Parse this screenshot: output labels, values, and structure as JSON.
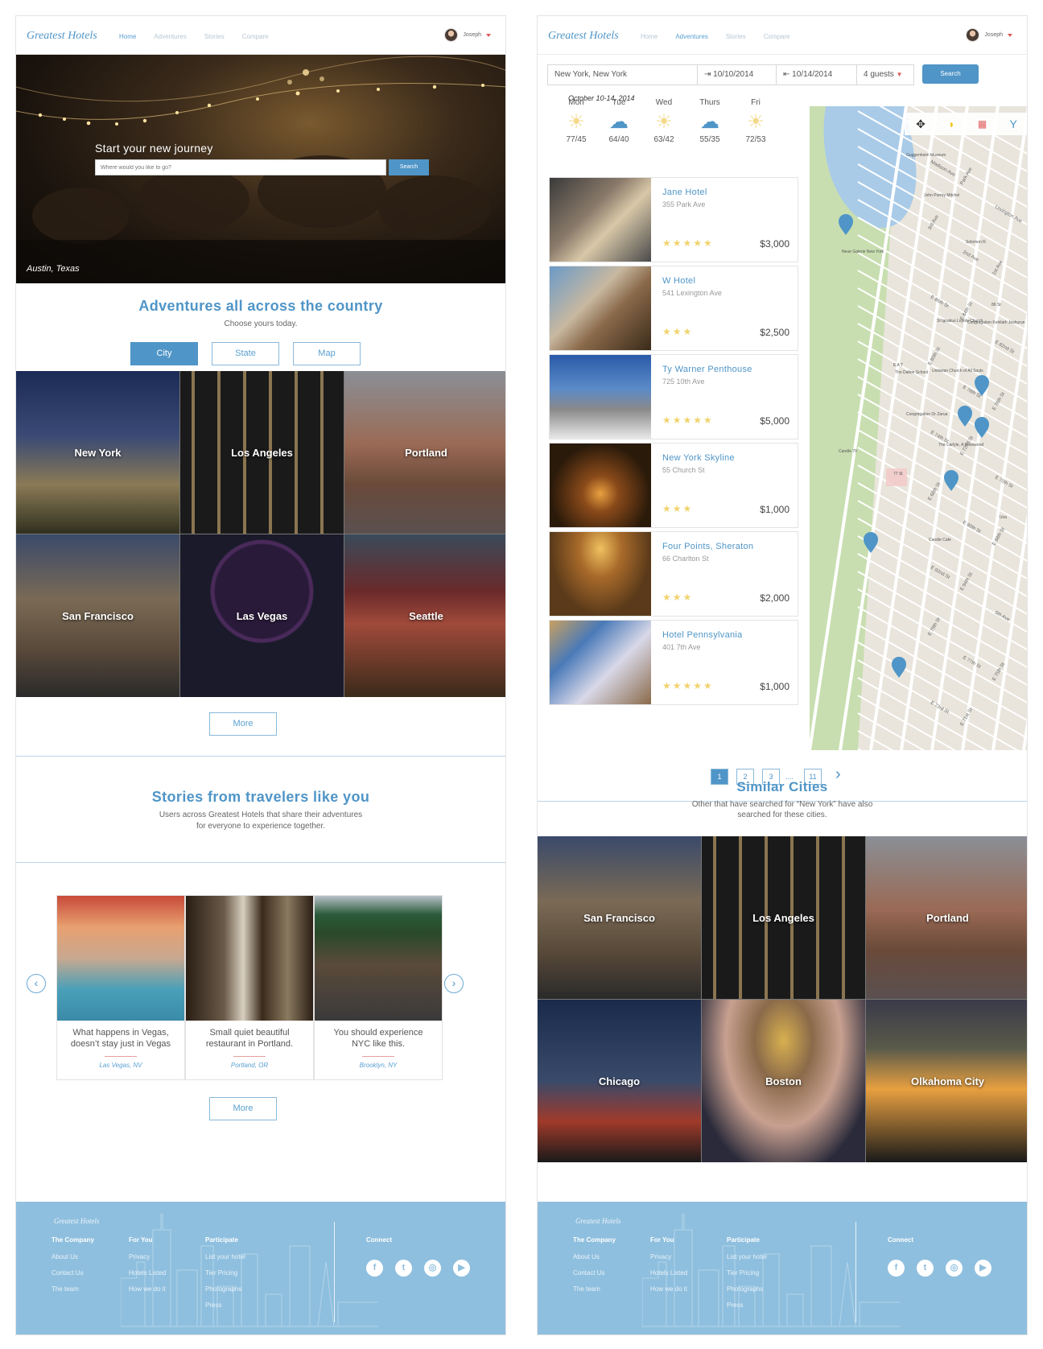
{
  "brand": {
    "logo": "Greatest Hotels"
  },
  "page1": {
    "nav": [
      "Home",
      "Adventures",
      "Stories",
      "Compare"
    ],
    "active": 0,
    "user": "Joseph",
    "hero": {
      "title": "Start your new journey",
      "placeholder": "Where would you like to go?",
      "button": "Search",
      "location": "Austin, Texas"
    },
    "adventures": {
      "title": "Adventures all across the country",
      "subtitle": "Choose yours today.",
      "toggle": [
        "City",
        "State",
        "Map"
      ]
    },
    "cities": [
      "New York",
      "Los Angeles",
      "Portland",
      "San Francisco",
      "Las Vegas",
      "Seattle"
    ],
    "more": "More",
    "stories": {
      "title": "Stories from travelers like you",
      "subtitle1": "Users across Greatest Hotels that share their adventures",
      "subtitle2": "for everyone to experience together.",
      "cards": [
        {
          "line1": "What happens in Vegas,",
          "line2": "doesn’t stay just in Vegas",
          "loc": "Las Vegas, NV"
        },
        {
          "line1": "Small quiet beautiful",
          "line2": "restaurant in Portland.",
          "loc": "Portland, OR"
        },
        {
          "line1": "You should experience",
          "line2": "NYC like this.",
          "loc": "Brooklyn, NY"
        }
      ],
      "more": "More"
    }
  },
  "footer": {
    "logo": "Greatest Hotels",
    "company": {
      "title": "The Company",
      "items": [
        "About Us",
        "Contact Us",
        "The team"
      ]
    },
    "foryou": {
      "title": "For You",
      "items": [
        "Privacy",
        "Hotels Listed",
        "How we do it"
      ]
    },
    "participate": {
      "title": "Participate",
      "items": [
        "List your hotel",
        "Tier Pricing",
        "Photographs",
        "Press"
      ]
    },
    "connect": "Connect",
    "social": [
      "f",
      "t",
      "ig",
      "yt"
    ]
  },
  "page2": {
    "nav": [
      "Home",
      "Adventures",
      "Stories",
      "Compare"
    ],
    "active": 1,
    "user": "Joseph",
    "search": {
      "location": "New York, New York",
      "checkin": "10/10/2014",
      "checkout": "10/14/2014",
      "guests": "4 guests",
      "button": "Search"
    },
    "weather": {
      "range": "October 10-14, 2014",
      "days": [
        {
          "day": "Mon",
          "icon": "sun-icon",
          "temp": "77/45"
        },
        {
          "day": "Tue",
          "icon": "cloud-icon",
          "temp": "64/40"
        },
        {
          "day": "Wed",
          "icon": "sun-icon",
          "temp": "63/42"
        },
        {
          "day": "Thurs",
          "icon": "cloud-icon",
          "temp": "55/35"
        },
        {
          "day": "Fri",
          "icon": "sun-icon",
          "temp": "72/53"
        }
      ]
    },
    "hotels": [
      {
        "name": "Jane Hotel",
        "address": "355 Park Ave",
        "stars": 5,
        "price": "$3,000"
      },
      {
        "name": "W Hotel",
        "address": "541 Lexington Ave",
        "stars": 3,
        "price": "$2,500"
      },
      {
        "name": "Ty Warner Penthouse",
        "address": "725 10th Ave",
        "stars": 5,
        "price": "$5,000"
      },
      {
        "name": "New York Skyline",
        "address": "55 Church St",
        "stars": 3,
        "price": "$1,000"
      },
      {
        "name": "Four Points, Sheraton",
        "address": "66 Charlton St",
        "stars": 3,
        "price": "$2,000"
      },
      {
        "name": "Hotel Pennsylvania",
        "address": "401 7th Ave",
        "stars": 5,
        "price": "$1,000"
      }
    ],
    "pagination": [
      "1",
      "2",
      "3",
      "....",
      "11"
    ],
    "similar": {
      "title": "Similar Cities",
      "subtitle1": "Other that have searched for “New York” have also",
      "subtitle2": "searched for these cities."
    },
    "cities": [
      "San Francisco",
      "Los Angeles",
      "Portland",
      "Chicago",
      "Boston",
      "Olkahoma City"
    ]
  },
  "map_labels": [
    "Neue Galerie New York",
    "Guggenheim Museum",
    "John Purroy Mitchel",
    "Solomon R.",
    "The Dalton School",
    "Congregation Or Zarua",
    "Unitarian Church of All Souls",
    "The Carlyle, A Rosewood",
    "Candle 79",
    "Candle Cafe",
    "St Ignatius Loyola Church",
    "Congregation Kehilath Jeshurun",
    "86 St",
    "77 St",
    "E A T",
    "Uva",
    "Madison Ave",
    "Park Ave",
    "Lexington Ave",
    "3rd Ave",
    "2nd Ave",
    "1st Ave",
    "E 86th St",
    "E 84th St",
    "E 82nd St",
    "E 80th St",
    "E 78th St",
    "E 76th St",
    "E 74th St",
    "E 72nd St",
    "E 70th St",
    "E 68th St",
    "E 90th St",
    "E 88th St",
    "E 92nd St",
    "E 94th St",
    "5th Ave",
    "E 79th St",
    "E 77th St",
    "E 75th St",
    "E 73rd St",
    "E 71st St"
  ],
  "colors": {
    "accent": "#4f95c7",
    "footer": "#8fbfde",
    "star": "#f1d36e",
    "map": "#e9e5dc",
    "park": "#c8deb0",
    "water": "#a9cbe8",
    "pin": "#4f95c7"
  }
}
